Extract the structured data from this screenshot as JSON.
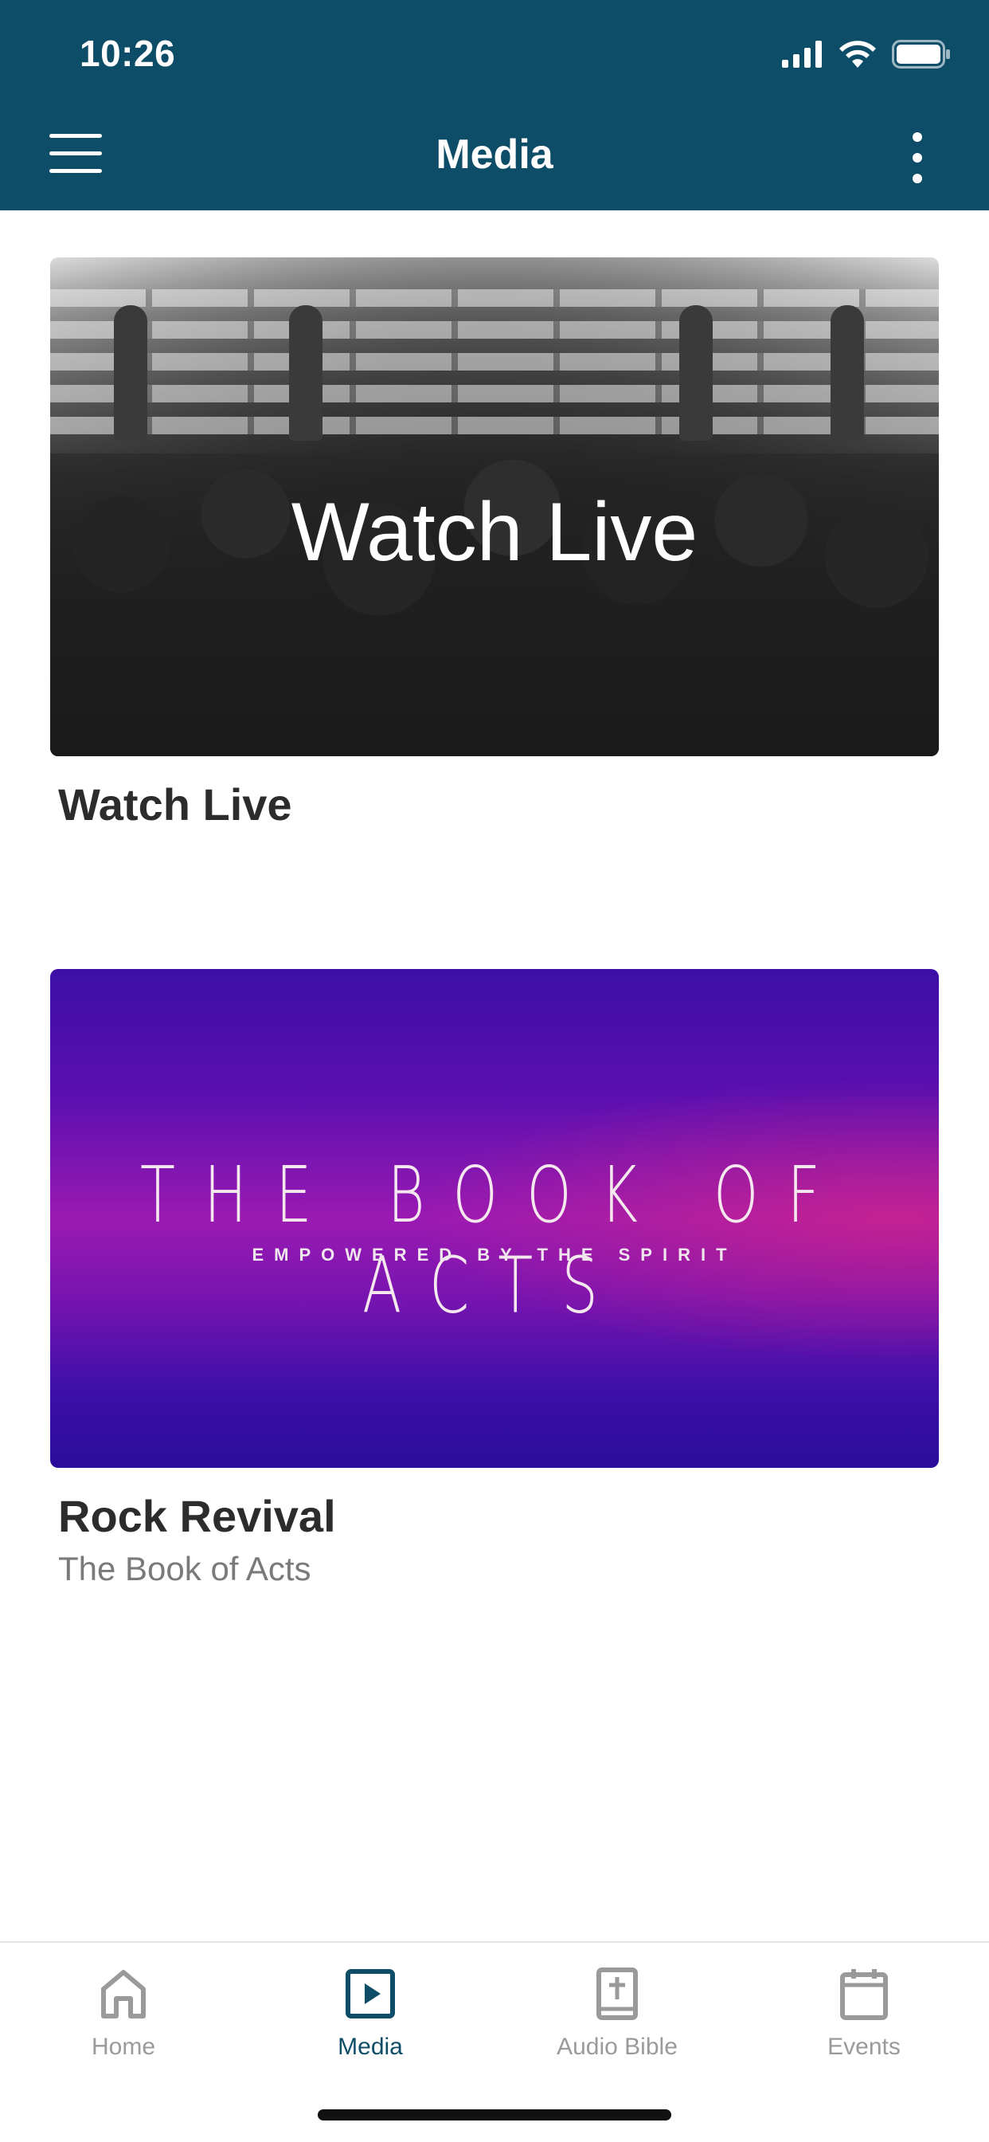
{
  "status_bar": {
    "time": "10:26",
    "icons": [
      "signal-icon",
      "wifi-icon",
      "battery-icon"
    ]
  },
  "header": {
    "title": "Media",
    "left_icon": "hamburger-menu-icon",
    "right_icon": "more-vertical-icon",
    "background": "#0e4d68"
  },
  "cards": [
    {
      "overlay_text": "Watch Live",
      "title": "Watch Live",
      "subtitle": ""
    },
    {
      "banner_title": "THE BOOK OF ACTS",
      "banner_subtitle": "EMPOWERED BY THE SPIRIT",
      "title": "Rock Revival",
      "subtitle": "The Book of Acts"
    }
  ],
  "tabs": [
    {
      "label": "Home",
      "icon": "home-icon",
      "active": false
    },
    {
      "label": "Media",
      "icon": "play-icon",
      "active": true
    },
    {
      "label": "Audio Bible",
      "icon": "bible-icon",
      "active": false
    },
    {
      "label": "Events",
      "icon": "calendar-icon",
      "active": false
    }
  ],
  "colors": {
    "accent": "#0e4d68",
    "tab_inactive": "#9a9a9a"
  }
}
